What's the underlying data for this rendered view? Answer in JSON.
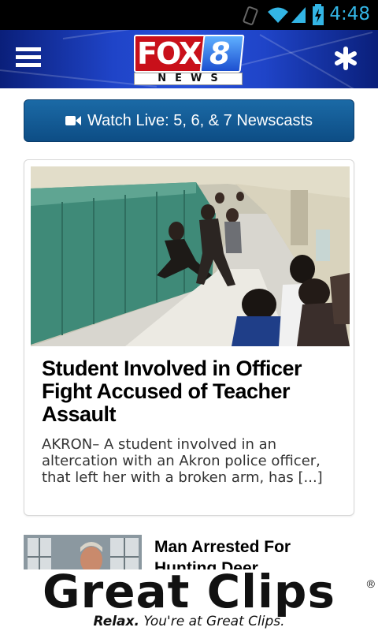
{
  "status_bar": {
    "time": "4:48",
    "icons": [
      "vibrate-icon",
      "wifi-icon",
      "signal-icon",
      "battery-charging-icon"
    ],
    "accent_color": "#33b5e5"
  },
  "header": {
    "logo_top": "FOX",
    "logo_number": "8",
    "logo_bottom": "NEWS",
    "menu_icon": "hamburger-menu-icon",
    "right_icon": "asterisk-icon"
  },
  "watch_button": {
    "icon": "video-camera-icon",
    "label": "Watch Live: 5, 6, & 7 Newscasts",
    "color": "#0d4d85"
  },
  "featured_story": {
    "title": "Student Involved in Officer Fight Accused of Teacher Assault",
    "summary": "AKRON– A student involved in an altercation with an Akron police officer, that left her with a broken arm, has [...]"
  },
  "stories": [
    {
      "title": "Man Arrested For Hunting Deer"
    }
  ],
  "ad": {
    "brand": "Great Clips",
    "registered": "®",
    "tagline_italic": "Relax.",
    "tagline_rest": " You're at Great Clips."
  }
}
